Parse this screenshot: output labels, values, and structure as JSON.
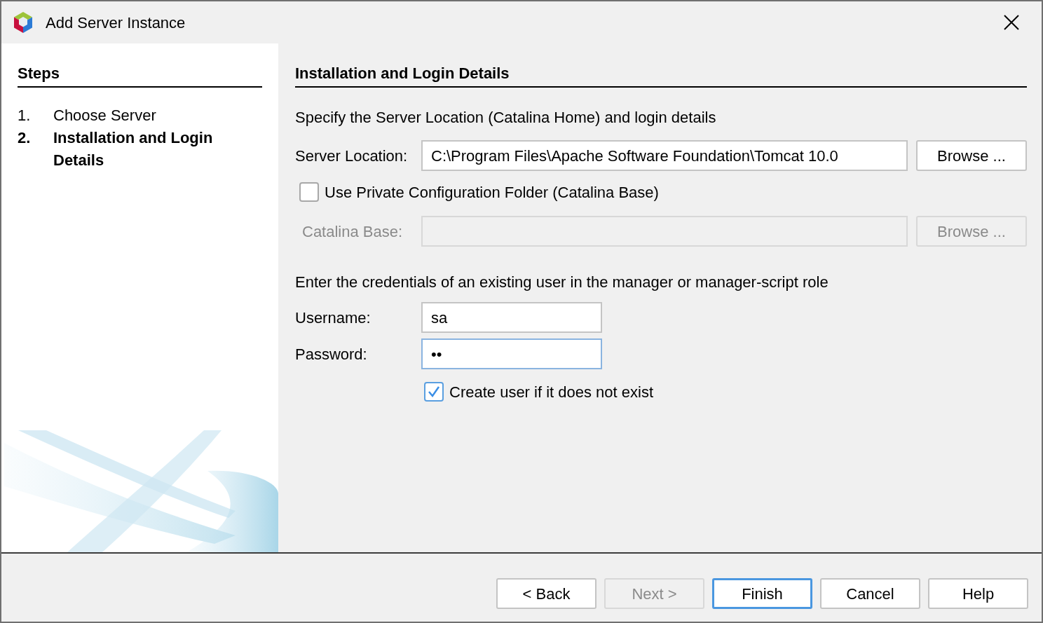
{
  "window": {
    "title": "Add Server Instance"
  },
  "steps": {
    "title": "Steps",
    "items": [
      {
        "number": "1.",
        "label": "Choose Server",
        "selected": false
      },
      {
        "number": "2.",
        "label": "Installation and Login Details",
        "selected": true
      }
    ]
  },
  "panel": {
    "title": "Installation and Login Details",
    "location_intro": "Specify the Server Location (Catalina Home) and login details",
    "server_location": {
      "label": "Server Location:",
      "value": "C:\\Program Files\\Apache Software Foundation\\Tomcat 10.0",
      "disabled": false,
      "browse": {
        "label": "Browse ...",
        "disabled": false
      }
    },
    "private_config": {
      "label": "Use Private Configuration Folder (Catalina Base)",
      "checked": false
    },
    "catalina_base": {
      "label": "Catalina Base:",
      "disabled": true,
      "browse": {
        "label": "Browse ...",
        "disabled": true
      }
    },
    "credentials_intro": "Enter the credentials of an existing user in the manager or manager-script role",
    "username": {
      "label": "Username:",
      "value": "sa",
      "focused": false
    },
    "password": {
      "label": "Password:",
      "value": "••",
      "focused": true
    },
    "create_user": {
      "label": "Create user if it does not exist",
      "checked": true
    }
  },
  "buttons": [
    {
      "label": "< Back",
      "disabled": false,
      "default": false
    },
    {
      "label": "Next >",
      "disabled": true,
      "default": false
    },
    {
      "label": "Finish",
      "disabled": false,
      "default": true
    },
    {
      "label": "Cancel",
      "disabled": false,
      "default": false
    },
    {
      "label": "Help",
      "disabled": false,
      "default": false
    }
  ]
}
